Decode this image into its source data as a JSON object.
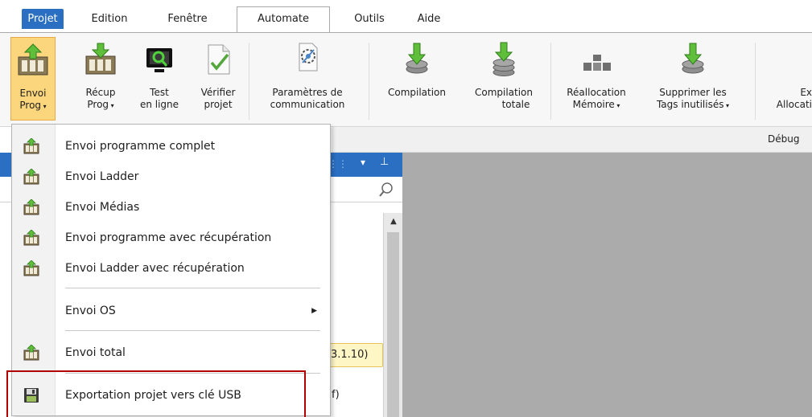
{
  "menubar": {
    "tabs": [
      {
        "label": "Projet",
        "state": "file"
      },
      {
        "label": "Edition",
        "state": "normal"
      },
      {
        "label": "Fenêtre",
        "state": "normal"
      },
      {
        "label": "Automate",
        "state": "active"
      },
      {
        "label": "Outils",
        "state": "normal"
      },
      {
        "label": "Aide",
        "state": "normal"
      }
    ]
  },
  "ribbon": {
    "buttons": [
      {
        "label1": "Envoi",
        "label2": "Prog",
        "dropdown": true,
        "selected": true,
        "icon": "upload-to-plc-icon"
      },
      {
        "label1": "Récup",
        "label2": "Prog",
        "dropdown": true,
        "selected": false,
        "icon": "download-from-plc-icon"
      },
      {
        "label1": "Test",
        "label2": "en ligne",
        "dropdown": false,
        "selected": false,
        "icon": "online-test-icon"
      },
      {
        "label1": "Vérifier",
        "label2": "projet",
        "dropdown": false,
        "selected": false,
        "icon": "verify-project-icon"
      },
      {
        "label1": "Paramètres de",
        "label2": "communication",
        "dropdown": false,
        "selected": false,
        "icon": "communication-settings-icon"
      },
      {
        "label1": "Compilation",
        "label2": "",
        "dropdown": false,
        "selected": false,
        "icon": "compile-icon"
      },
      {
        "label1": "Compilation",
        "label2": "totale",
        "dropdown": false,
        "selected": false,
        "icon": "full-compile-icon"
      },
      {
        "label1": "Réallocation",
        "label2": "Mémoire",
        "dropdown": true,
        "selected": false,
        "icon": "memory-realloc-icon"
      },
      {
        "label1": "Supprimer les",
        "label2": "Tags inutilisés",
        "dropdown": true,
        "selected": false,
        "icon": "delete-unused-tags-icon"
      },
      {
        "label1": "Ex",
        "label2": "Allocati",
        "dropdown": false,
        "selected": false,
        "icon": ""
      }
    ],
    "group_label": "Débug"
  },
  "dropdown": {
    "items": [
      {
        "type": "item",
        "label": "Envoi programme complet",
        "icon": "upload-plc-icon"
      },
      {
        "type": "item",
        "label": "Envoi Ladder",
        "icon": "upload-plc-icon"
      },
      {
        "type": "item",
        "label": "Envoi Médias",
        "icon": "upload-plc-icon"
      },
      {
        "type": "item",
        "label": "Envoi programme avec récupération",
        "icon": "upload-plc-icon"
      },
      {
        "type": "item",
        "label": "Envoi Ladder avec récupération",
        "icon": "upload-plc-icon"
      },
      {
        "type": "separator"
      },
      {
        "type": "submenu",
        "label": "Envoi OS",
        "icon": ""
      },
      {
        "type": "separator"
      },
      {
        "type": "item",
        "label": "Envoi total",
        "icon": "upload-plc-icon"
      },
      {
        "type": "separator"
      },
      {
        "type": "item",
        "label": "Exportation projet vers clé USB",
        "icon": "save-disk-icon"
      }
    ],
    "submenu_arrow": "▶"
  },
  "left_pane": {
    "header_icons": [
      "⋮⋮",
      "▾",
      "⊥"
    ],
    "search_icon": "search-icon",
    "tree_badge": "3.1.10)",
    "tree_partial": "f)",
    "scroll_up": "▲"
  },
  "colors": {
    "accent_blue": "#2a6fc1",
    "selected_button": "#fbd67d",
    "highlight_red": "#b00000",
    "workspace_gray": "#ababab"
  }
}
